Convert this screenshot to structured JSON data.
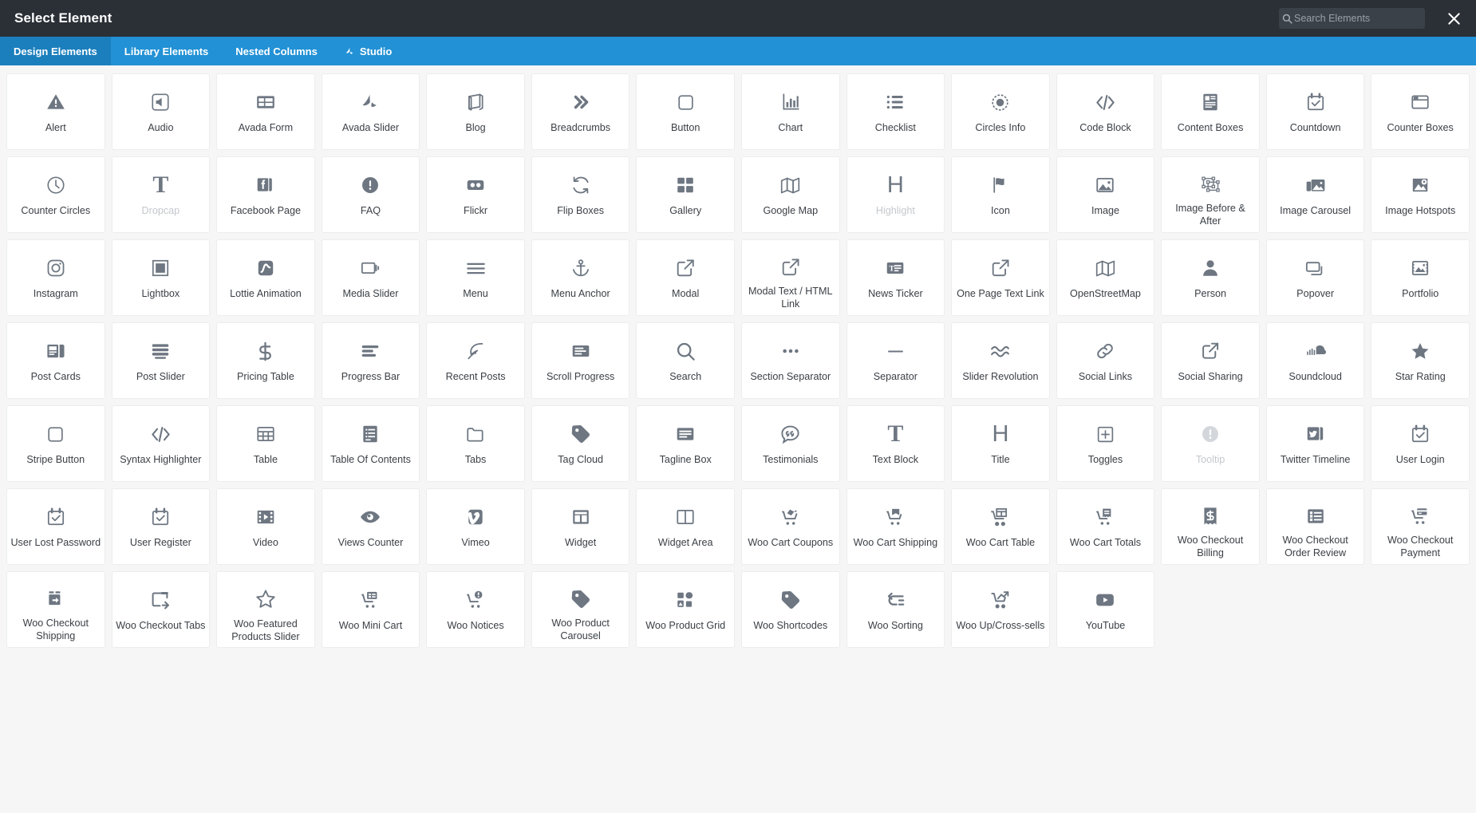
{
  "window": {
    "title": "Select Element",
    "close_label": "×",
    "close_icon": "close-icon"
  },
  "search": {
    "placeholder": "Search Elements",
    "value": "",
    "icon": "search-icon"
  },
  "colors": {
    "titlebar_bg": "#2b3037",
    "tabbar_bg": "#2291d5",
    "tab_active_bg": "#1b7fbd",
    "icon": "#6d7681",
    "icon_disabled": "#d3d7dc",
    "label": "#3b4046",
    "label_disabled": "#c4c8cd",
    "page_bg": "#f6f6f6",
    "card_bg": "#ffffff",
    "card_border": "#eceded"
  },
  "tabs": [
    {
      "label": "Design Elements",
      "active": true,
      "icon": null
    },
    {
      "label": "Library Elements",
      "active": false,
      "icon": null
    },
    {
      "label": "Nested Columns",
      "active": false,
      "icon": null
    },
    {
      "label": "Studio",
      "active": false,
      "icon": "avada-logo-icon"
    }
  ],
  "elements": [
    {
      "label": "Alert",
      "icon": "alert-triangle-icon",
      "disabled": false
    },
    {
      "label": "Audio",
      "icon": "audio-speaker-icon",
      "disabled": false
    },
    {
      "label": "Avada Form",
      "icon": "form-layout-icon",
      "disabled": false
    },
    {
      "label": "Avada Slider",
      "icon": "avada-logo-icon",
      "disabled": false
    },
    {
      "label": "Blog",
      "icon": "book-icon",
      "disabled": false
    },
    {
      "label": "Breadcrumbs",
      "icon": "double-chevron-right-icon",
      "disabled": false
    },
    {
      "label": "Button",
      "icon": "rounded-square-icon",
      "disabled": false
    },
    {
      "label": "Chart",
      "icon": "bar-chart-icon",
      "disabled": false
    },
    {
      "label": "Checklist",
      "icon": "checklist-icon",
      "disabled": false
    },
    {
      "label": "Circles Info",
      "icon": "gear-circle-icon",
      "disabled": false
    },
    {
      "label": "Code Block",
      "icon": "code-brackets-icon",
      "disabled": false
    },
    {
      "label": "Content Boxes",
      "icon": "content-box-icon",
      "disabled": false
    },
    {
      "label": "Countdown",
      "icon": "calendar-check-icon",
      "disabled": false
    },
    {
      "label": "Counter Boxes",
      "icon": "browser-window-icon",
      "disabled": false
    },
    {
      "label": "Counter Circles",
      "icon": "clock-icon",
      "disabled": false
    },
    {
      "label": "Dropcap",
      "icon": "letter-t-icon",
      "disabled": true
    },
    {
      "label": "Facebook Page",
      "icon": "facebook-icon",
      "disabled": false
    },
    {
      "label": "FAQ",
      "icon": "exclamation-circle-icon",
      "disabled": false
    },
    {
      "label": "Flickr",
      "icon": "flickr-dots-icon",
      "disabled": false
    },
    {
      "label": "Flip Boxes",
      "icon": "flip-refresh-icon",
      "disabled": false
    },
    {
      "label": "Gallery",
      "icon": "grid-squares-icon",
      "disabled": false
    },
    {
      "label": "Google Map",
      "icon": "folded-map-icon",
      "disabled": false
    },
    {
      "label": "Highlight",
      "icon": "letter-h-icon",
      "disabled": true
    },
    {
      "label": "Icon",
      "icon": "flag-icon",
      "disabled": false
    },
    {
      "label": "Image",
      "icon": "picture-icon",
      "disabled": false
    },
    {
      "label": "Image Before & After",
      "icon": "transform-handles-icon",
      "disabled": false
    },
    {
      "label": "Image Carousel",
      "icon": "images-stack-icon",
      "disabled": false
    },
    {
      "label": "Image Hotspots",
      "icon": "image-pin-icon",
      "disabled": false
    },
    {
      "label": "Instagram",
      "icon": "instagram-icon",
      "disabled": false
    },
    {
      "label": "Lightbox",
      "icon": "framed-square-icon",
      "disabled": false
    },
    {
      "label": "Lottie Animation",
      "icon": "lottie-curve-icon",
      "disabled": false
    },
    {
      "label": "Media Slider",
      "icon": "media-slider-icon",
      "disabled": false
    },
    {
      "label": "Menu",
      "icon": "hamburger-menu-icon",
      "disabled": false
    },
    {
      "label": "Menu Anchor",
      "icon": "anchor-icon",
      "disabled": false
    },
    {
      "label": "Modal",
      "icon": "external-link-box-icon",
      "disabled": false
    },
    {
      "label": "Modal Text / HTML Link",
      "icon": "external-link-arrow-icon",
      "disabled": false
    },
    {
      "label": "News Ticker",
      "icon": "ticker-text-icon",
      "disabled": false
    },
    {
      "label": "One Page Text Link",
      "icon": "external-link-arrow-icon",
      "disabled": false
    },
    {
      "label": "OpenStreetMap",
      "icon": "folded-map-icon",
      "disabled": false
    },
    {
      "label": "Person",
      "icon": "person-icon",
      "disabled": false
    },
    {
      "label": "Popover",
      "icon": "popover-icon",
      "disabled": false
    },
    {
      "label": "Portfolio",
      "icon": "portfolio-image-icon",
      "disabled": false
    },
    {
      "label": "Post Cards",
      "icon": "post-cards-icon",
      "disabled": false
    },
    {
      "label": "Post Slider",
      "icon": "stacked-lines-icon",
      "disabled": false
    },
    {
      "label": "Pricing Table",
      "icon": "dollar-sign-icon",
      "disabled": false
    },
    {
      "label": "Progress Bar",
      "icon": "progress-bars-icon",
      "disabled": false
    },
    {
      "label": "Recent Posts",
      "icon": "feather-pen-icon",
      "disabled": false
    },
    {
      "label": "Scroll Progress",
      "icon": "scroll-progress-icon",
      "disabled": false
    },
    {
      "label": "Search",
      "icon": "magnifier-icon",
      "disabled": false
    },
    {
      "label": "Section Separator",
      "icon": "three-dots-icon",
      "disabled": false
    },
    {
      "label": "Separator",
      "icon": "horizontal-line-icon",
      "disabled": false
    },
    {
      "label": "Slider Revolution",
      "icon": "waves-icon",
      "disabled": false
    },
    {
      "label": "Social Links",
      "icon": "chain-link-icon",
      "disabled": false
    },
    {
      "label": "Social Sharing",
      "icon": "share-box-icon",
      "disabled": false
    },
    {
      "label": "Soundcloud",
      "icon": "soundcloud-icon",
      "disabled": false
    },
    {
      "label": "Star Rating",
      "icon": "star-filled-icon",
      "disabled": false
    },
    {
      "label": "Stripe Button",
      "icon": "rounded-square-icon",
      "disabled": false
    },
    {
      "label": "Syntax Highlighter",
      "icon": "code-brackets-icon",
      "disabled": false
    },
    {
      "label": "Table",
      "icon": "table-grid-icon",
      "disabled": false
    },
    {
      "label": "Table Of Contents",
      "icon": "document-list-icon",
      "disabled": false
    },
    {
      "label": "Tabs",
      "icon": "folder-tab-icon",
      "disabled": false
    },
    {
      "label": "Tag Cloud",
      "icon": "tag-icon",
      "disabled": false
    },
    {
      "label": "Tagline Box",
      "icon": "tagline-box-icon",
      "disabled": false
    },
    {
      "label": "Testimonials",
      "icon": "speech-bubble-quote-icon",
      "disabled": false
    },
    {
      "label": "Text Block",
      "icon": "letter-t-bold-icon",
      "disabled": false
    },
    {
      "label": "Title",
      "icon": "letter-h-icon",
      "disabled": false
    },
    {
      "label": "Toggles",
      "icon": "plus-box-icon",
      "disabled": false
    },
    {
      "label": "Tooltip",
      "icon": "exclamation-circle-icon",
      "disabled": true
    },
    {
      "label": "Twitter Timeline",
      "icon": "twitter-icon",
      "disabled": false
    },
    {
      "label": "User Login",
      "icon": "calendar-check-icon",
      "disabled": false
    },
    {
      "label": "User Lost Password",
      "icon": "calendar-check-icon",
      "disabled": false
    },
    {
      "label": "User Register",
      "icon": "calendar-check-icon",
      "disabled": false
    },
    {
      "label": "Video",
      "icon": "film-play-icon",
      "disabled": false
    },
    {
      "label": "Views Counter",
      "icon": "eye-icon",
      "disabled": false
    },
    {
      "label": "Vimeo",
      "icon": "vimeo-icon",
      "disabled": false
    },
    {
      "label": "Widget",
      "icon": "widget-icon",
      "disabled": false
    },
    {
      "label": "Widget Area",
      "icon": "widget-area-icon",
      "disabled": false
    },
    {
      "label": "Woo Cart Coupons",
      "icon": "cart-coupon-icon",
      "disabled": false
    },
    {
      "label": "Woo Cart Shipping",
      "icon": "cart-shipping-icon",
      "disabled": false
    },
    {
      "label": "Woo Cart Table",
      "icon": "cart-table-icon",
      "disabled": false
    },
    {
      "label": "Woo Cart Totals",
      "icon": "cart-receipt-icon",
      "disabled": false
    },
    {
      "label": "Woo Checkout Billing",
      "icon": "receipt-dollar-icon",
      "disabled": false
    },
    {
      "label": "Woo Checkout Order Review",
      "icon": "order-list-icon",
      "disabled": false
    },
    {
      "label": "Woo Checkout Payment",
      "icon": "cart-card-icon",
      "disabled": false
    },
    {
      "label": "Woo Checkout Shipping",
      "icon": "box-arrow-icon",
      "disabled": false
    },
    {
      "label": "Woo Checkout Tabs",
      "icon": "tab-arrow-icon",
      "disabled": false
    },
    {
      "label": "Woo Featured Products Slider",
      "icon": "star-outline-icon",
      "disabled": false
    },
    {
      "label": "Woo Mini Cart",
      "icon": "cart-list-icon",
      "disabled": false
    },
    {
      "label": "Woo Notices",
      "icon": "cart-alert-icon",
      "disabled": false
    },
    {
      "label": "Woo Product Carousel",
      "icon": "tag-icon",
      "disabled": false
    },
    {
      "label": "Woo Product Grid",
      "icon": "product-grid-icon",
      "disabled": false
    },
    {
      "label": "Woo Shortcodes",
      "icon": "tag-icon",
      "disabled": false
    },
    {
      "label": "Woo Sorting",
      "icon": "sort-arrow-icon",
      "disabled": false
    },
    {
      "label": "Woo Up/Cross-sells",
      "icon": "cart-trend-icon",
      "disabled": false
    },
    {
      "label": "YouTube",
      "icon": "youtube-icon",
      "disabled": false
    }
  ]
}
